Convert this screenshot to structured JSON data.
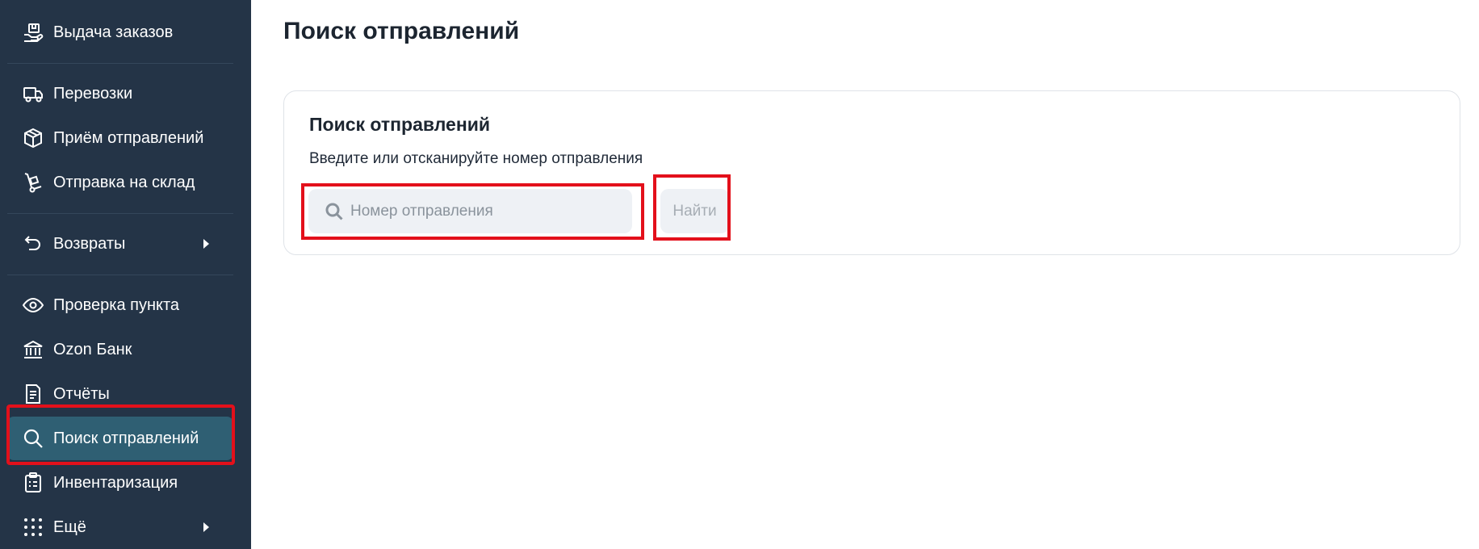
{
  "sidebar": {
    "items": [
      {
        "label": "Выдача заказов",
        "icon": "hand-package-icon"
      },
      {
        "label": "Перевозки",
        "icon": "truck-icon"
      },
      {
        "label": "Приём отправлений",
        "icon": "box-icon"
      },
      {
        "label": "Отправка на склад",
        "icon": "hand-truck-icon"
      },
      {
        "label": "Возвраты",
        "icon": "return-arrow-icon"
      },
      {
        "label": "Проверка пункта",
        "icon": "eye-icon"
      },
      {
        "label": "Ozon Банк",
        "icon": "bank-icon"
      },
      {
        "label": "Отчёты",
        "icon": "document-icon"
      },
      {
        "label": "Поиск отправлений",
        "icon": "search-icon",
        "active": true
      },
      {
        "label": "Инвентаризация",
        "icon": "clipboard-icon"
      },
      {
        "label": "Ещё",
        "icon": "grid-dots-icon"
      }
    ]
  },
  "main": {
    "title": "Поиск отправлений",
    "card": {
      "title": "Поиск отправлений",
      "hint": "Введите или отсканируйте номер отправления",
      "search": {
        "placeholder": "Номер отправления",
        "value": ""
      },
      "button_label": "Найти"
    }
  },
  "colors": {
    "sidebar_bg": "#243447",
    "active_item_bg": "#2f5f73",
    "highlight": "#e3101b"
  }
}
